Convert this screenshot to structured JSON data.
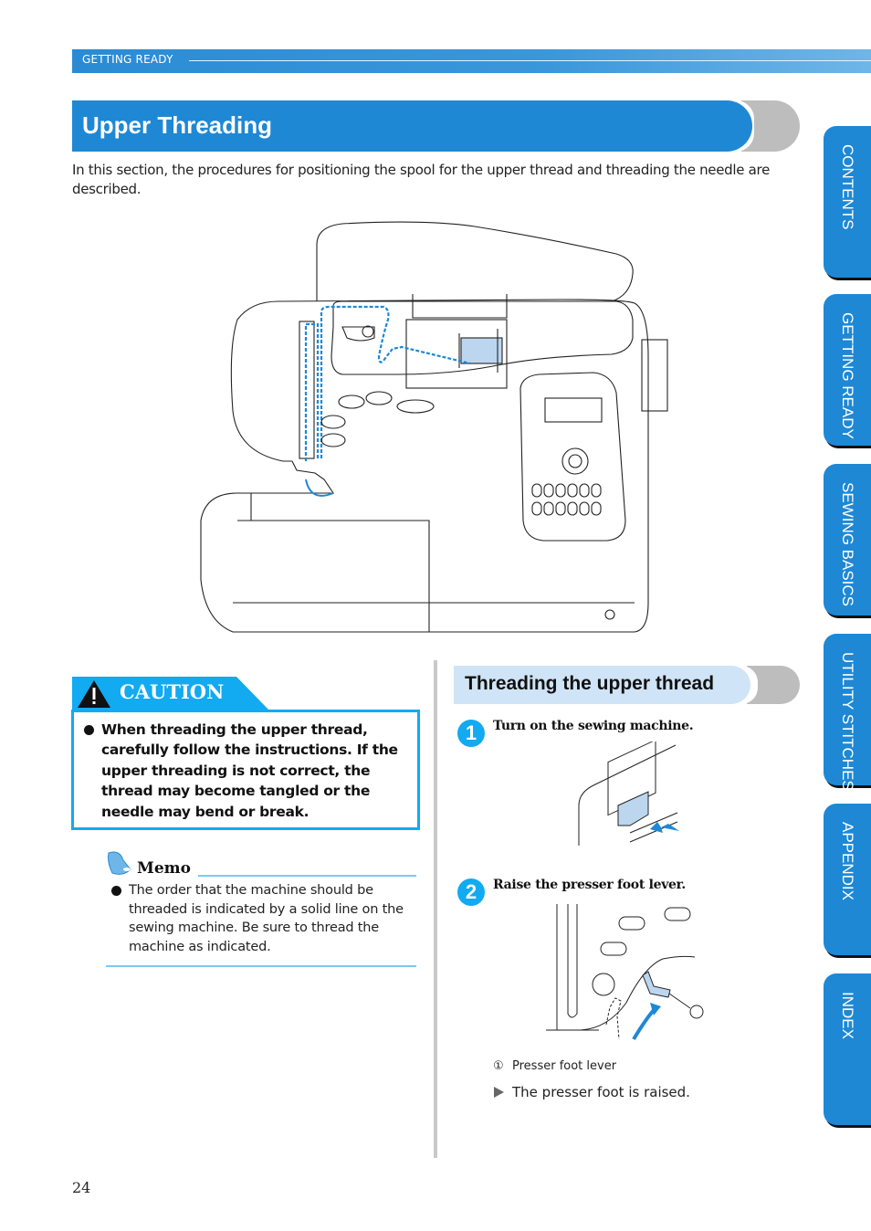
{
  "header": {
    "section_label": "GETTING READY"
  },
  "title": "Upper Threading",
  "intro": "In this section, the procedures for positioning the spool for the upper thread and threading the needle are described.",
  "side_tabs": [
    {
      "label": "CONTENTS"
    },
    {
      "label": "GETTING READY"
    },
    {
      "label": "SEWING BASICS"
    },
    {
      "label": "UTILITY STITCHES"
    },
    {
      "label": "APPENDIX"
    },
    {
      "label": "INDEX"
    }
  ],
  "illustration": {
    "subject": "sewing-machine-threading-path",
    "thread_color": "#1e88d5"
  },
  "caution": {
    "heading": "CAUTION",
    "text": "When threading the upper thread, carefully follow the instructions. If the upper threading is not correct, the thread may become tangled or the needle may bend or break."
  },
  "memo": {
    "heading": "Memo",
    "text": "The order that the machine should be threaded is indicated by a solid line on the sewing machine. Be sure to thread the machine as indicated."
  },
  "procedure": {
    "heading": "Threading the upper thread",
    "steps": [
      {
        "number": "1",
        "text": "Turn on the sewing machine."
      },
      {
        "number": "2",
        "text": "Raise the presser foot lever."
      }
    ],
    "callouts": [
      {
        "marker": "①",
        "label": "Presser foot lever"
      }
    ],
    "result": "The presser foot is raised."
  },
  "page_number": "24",
  "colors": {
    "brand_blue": "#1e88d5",
    "caution_cyan": "#12aaf0",
    "memo_rule": "#7cc8f3",
    "subheading_bg": "#cfe4f6"
  }
}
